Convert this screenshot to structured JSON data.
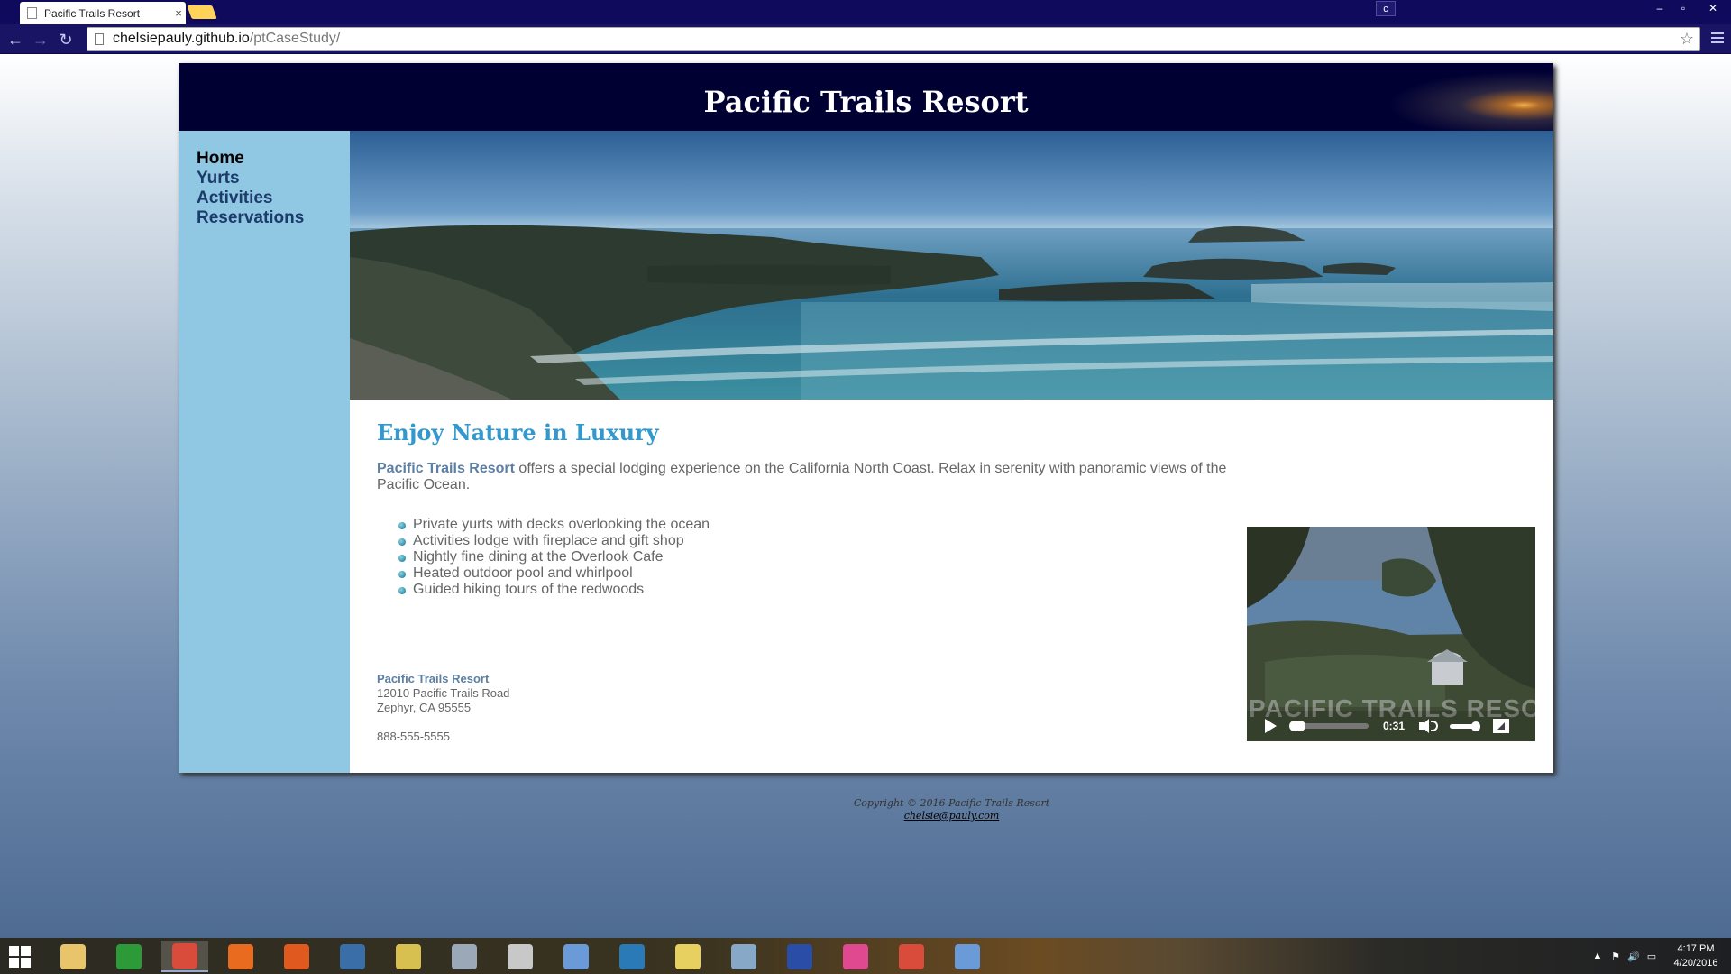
{
  "browser": {
    "tab_title": "Pacific Trails Resort",
    "tab_close": "×",
    "user_badge": "c",
    "url_host": "chelsiepauly.github.io",
    "url_path": "/ptCaseStudy/",
    "window_controls": [
      "–",
      "▫",
      "✕"
    ],
    "back_icon": "←",
    "forward_icon": "→",
    "reload_icon": "↻",
    "star_icon": "☆"
  },
  "site": {
    "title": "Pacific Trails Resort",
    "nav": [
      {
        "label": "Home",
        "active": true
      },
      {
        "label": "Yurts"
      },
      {
        "label": "Activities"
      },
      {
        "label": "Reservations"
      }
    ],
    "heading": "Enjoy Nature in Luxury",
    "intro_brand": "Pacific Trails Resort",
    "intro_text": " offers a special lodging experience on the California North Coast. Relax in serenity with panoramic views of the Pacific Ocean.",
    "features": [
      "Private yurts with decks overlooking the ocean",
      "Activities lodge with fireplace and gift shop",
      "Nightly fine dining at the Overlook Cafe",
      "Heated outdoor pool and whirlpool",
      "Guided hiking tours of the redwoods"
    ],
    "contact": {
      "name": "Pacific Trails Resort",
      "street": "12010 Pacific Trails Road",
      "city": "Zephyr, CA 95555",
      "phone": "888-555-5555"
    },
    "video": {
      "watermark": "PACIFIC TRAILS RESORT",
      "time": "0:31",
      "progress": 0.0,
      "volume": 1.0
    },
    "footer": {
      "copyright": "Copyright © 2016 Pacific Trails Resort",
      "email": "chelsie@pauly.com"
    }
  },
  "taskbar": {
    "apps": [
      {
        "name": "file-explorer-icon",
        "color": "#e8c46a"
      },
      {
        "name": "store-icon",
        "color": "#2d9a3a"
      },
      {
        "name": "chrome-icon",
        "color": "#d94b3a",
        "active": true
      },
      {
        "name": "firefox-icon",
        "color": "#e86b1f"
      },
      {
        "name": "app-triad-icon",
        "color": "#e05a20"
      },
      {
        "name": "app-python-icon",
        "color": "#3a6ea8"
      },
      {
        "name": "app-python-file-icon",
        "color": "#d8c050"
      },
      {
        "name": "calculator-icon",
        "color": "#9aa8b8"
      },
      {
        "name": "app-editor-icon",
        "color": "#c8c8c8"
      },
      {
        "name": "app-paint-icon",
        "color": "#6a9ad8"
      },
      {
        "name": "app-n-icon",
        "color": "#2a7ab8"
      },
      {
        "name": "app-folder-icon",
        "color": "#e8d060"
      },
      {
        "name": "app-palette-icon",
        "color": "#88a8c8"
      },
      {
        "name": "visual-studio-icon",
        "color": "#2a4ea8"
      },
      {
        "name": "itunes-icon",
        "color": "#e04890"
      },
      {
        "name": "chrome-icon",
        "color": "#d94b3a"
      },
      {
        "name": "control-panel-icon",
        "color": "#6a9ad8"
      }
    ],
    "tray_icons": [
      "▲",
      "⚑",
      "🔊",
      "▭"
    ],
    "time": "4:17 PM",
    "date": "4/20/2016"
  }
}
